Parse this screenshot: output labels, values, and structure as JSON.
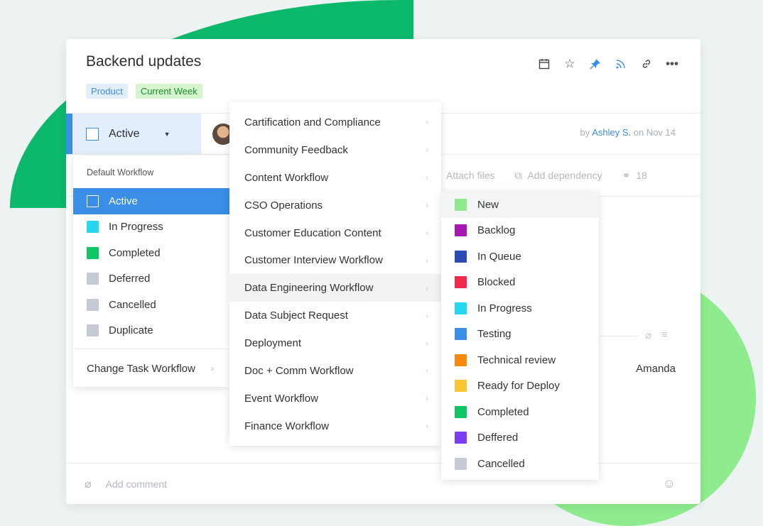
{
  "task": {
    "title": "Backend updates",
    "tags": [
      "Product",
      "Current Week"
    ],
    "status": "Active",
    "byline_prefix": "by",
    "author": "Ashley S.",
    "date_text": "on Nov 14",
    "attach_label": "Attach files",
    "dependency_label": "Add dependency",
    "share_count": "18",
    "assignee": "Amanda",
    "comment_placeholder": "Add comment"
  },
  "header_icons": [
    "calendar-icon",
    "star-icon",
    "pin-icon",
    "rss-icon",
    "link-icon",
    "more-icon"
  ],
  "workflow_menu": {
    "heading": "Default Workflow",
    "items": [
      {
        "label": "Active",
        "color": "#3a8ee6",
        "selected": true
      },
      {
        "label": "In Progress",
        "color": "#26d7f0"
      },
      {
        "label": "Completed",
        "color": "#11c466"
      },
      {
        "label": "Deferred",
        "color": "#c6cad6"
      },
      {
        "label": "Cancelled",
        "color": "#c6cad6"
      },
      {
        "label": "Duplicate",
        "color": "#c6cad6"
      }
    ],
    "change_label": "Change Task Workflow"
  },
  "workflows": [
    "Cartification and Compliance",
    "Community Feedback",
    "Content Workflow",
    "CSO Operations",
    "Customer Education Content",
    "Customer Interview Workflow",
    "Data Engineering Workflow",
    "Data Subject Request",
    "Deployment",
    "Doc + Comm Workflow",
    "Event Workflow",
    "Finance Workflow"
  ],
  "highlighted_workflow": "Data Engineering Workflow",
  "statuses": [
    {
      "label": "New",
      "color": "#8ee88e"
    },
    {
      "label": "Backlog",
      "color": "#a617b3"
    },
    {
      "label": "In Queue",
      "color": "#2d4bb8"
    },
    {
      "label": "Blocked",
      "color": "#f0284a"
    },
    {
      "label": "In Progress",
      "color": "#26d7f0"
    },
    {
      "label": "Testing",
      "color": "#3a8ee6"
    },
    {
      "label": "Technical review",
      "color": "#f78a0c"
    },
    {
      "label": "Ready for Deploy",
      "color": "#fbc431"
    },
    {
      "label": "Completed",
      "color": "#11c466"
    },
    {
      "label": "Deffered",
      "color": "#7b3ff0"
    },
    {
      "label": "Cancelled",
      "color": "#c6cad6"
    }
  ]
}
